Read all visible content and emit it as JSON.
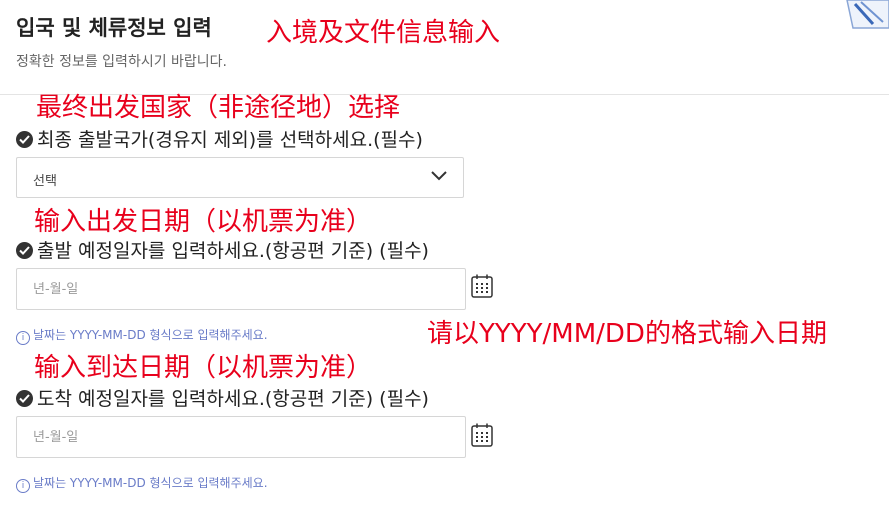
{
  "header": {
    "title": "입국 및 체류정보 입력",
    "subtitle": "정확한 정보를 입력하시기 바랍니다."
  },
  "annotations": {
    "title": "入境及文件信息输入",
    "departure_country": "最终出发国家（非途径地）选择",
    "departure_date": "输入出发日期（以机票为准）",
    "date_format": "请以YYYY/MM/DD的格式输入日期",
    "arrival_date": "输入到达日期（以机票为准）",
    "color": "#e8001c"
  },
  "form": {
    "departure_country": {
      "label": "최종 출발국가(경유지 제외)를 선택하세요.(필수)",
      "selected": "선택"
    },
    "departure_date": {
      "label": "출발 예정일자를 입력하세요.(항공편 기준) (필수)",
      "placeholder": "년-월-일",
      "hint": "날짜는 YYYY-MM-DD 형식으로 입력해주세요."
    },
    "arrival_date": {
      "label": "도착 예정일자를 입력하세요.(항공편 기준) (필수)",
      "placeholder": "년-월-일",
      "hint": "날짜는 YYYY-MM-DD 형식으로 입력해주세요."
    }
  },
  "icons": {
    "check": "check-circle-icon",
    "chevron": "chevron-down-icon",
    "calendar": "calendar-icon",
    "info": "info-icon"
  },
  "colors": {
    "hint": "#6a7cc8",
    "border": "#d6d6d6"
  }
}
